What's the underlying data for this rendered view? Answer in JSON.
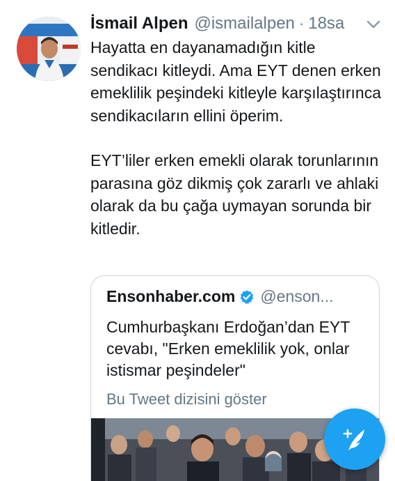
{
  "tweet": {
    "display_name": "İsmail Alpen",
    "handle": "@ismailalpen",
    "separator": "·",
    "time": "18sa",
    "paragraphs": [
      "Hayatta en dayanamadığın kitle sendikacı kitleydi. Ama EYT denen erken emeklilik peşindeki kitleyle karşılaştırınca sendikacıların ellini öperim.",
      "EYT’liler erken emekli olarak torunlarının parasına göz dikmiş çok zararlı ve ahlaki olarak da bu çağa uymayan sorunda bir kitledir."
    ]
  },
  "quoted_tweet": {
    "name": "Ensonhaber.com",
    "handle": "@enson...",
    "text": "Cumhurbaşkanı Erdoğan’dan EYT cevabı, \"Erken emeklilik yok, onlar istismar peşindeler\"",
    "show_thread": "Bu Tweet dizisini göster"
  },
  "icons": {
    "caret": "chevron-down-icon",
    "verified": "verified-badge-icon",
    "compose": "compose-tweet-icon"
  },
  "colors": {
    "text": "#14171a",
    "secondary": "#657786",
    "accent": "#1da1f2",
    "border": "#ccd6dd"
  }
}
